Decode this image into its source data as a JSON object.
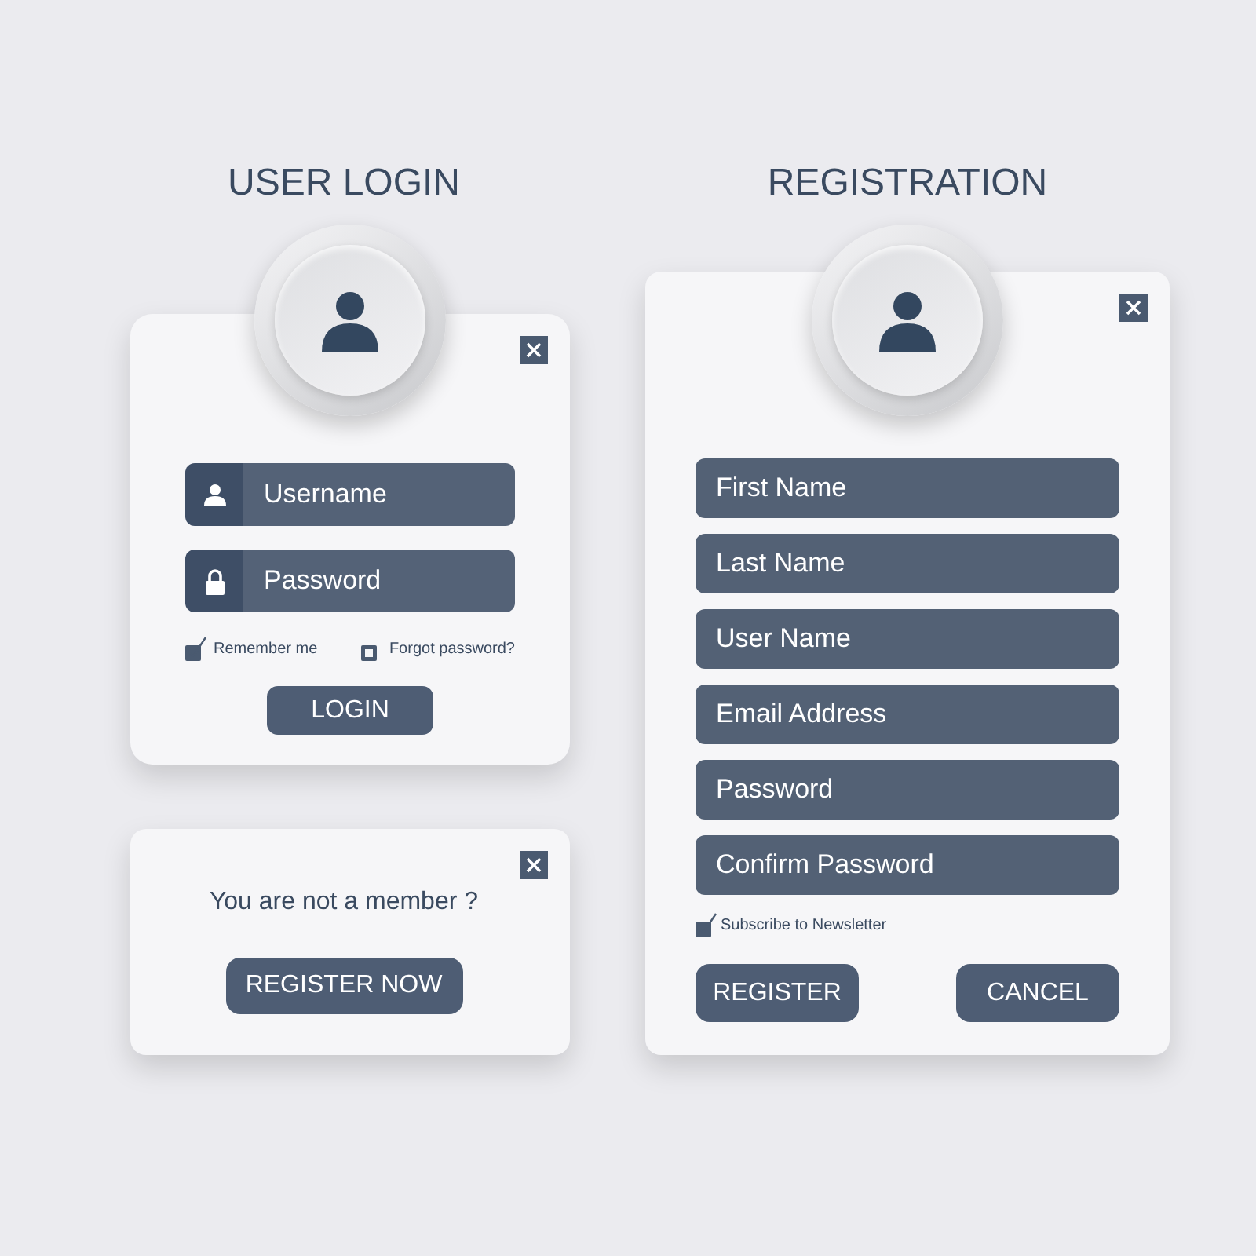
{
  "login": {
    "title": "USER LOGIN",
    "fields": [
      {
        "kind": "user",
        "placeholder": "Username"
      },
      {
        "kind": "lock",
        "placeholder": "Password"
      }
    ],
    "options": [
      {
        "label": "Remember me",
        "checked": true
      },
      {
        "label": "Forgot password?",
        "checked": false
      }
    ],
    "button": "LOGIN"
  },
  "member": {
    "text": "You are not a member ?",
    "button": "REGISTER NOW"
  },
  "registration": {
    "title": "REGISTRATION",
    "fields": [
      {
        "placeholder": "First Name"
      },
      {
        "placeholder": "Last Name"
      },
      {
        "placeholder": "User Name"
      },
      {
        "placeholder": "Email Address"
      },
      {
        "placeholder": "Password"
      },
      {
        "placeholder": "Confirm Password"
      }
    ],
    "newsletter": {
      "label": "Subscribe to Newsletter",
      "checked": true
    },
    "buttons": [
      "REGISTER",
      "CANCEL"
    ]
  }
}
